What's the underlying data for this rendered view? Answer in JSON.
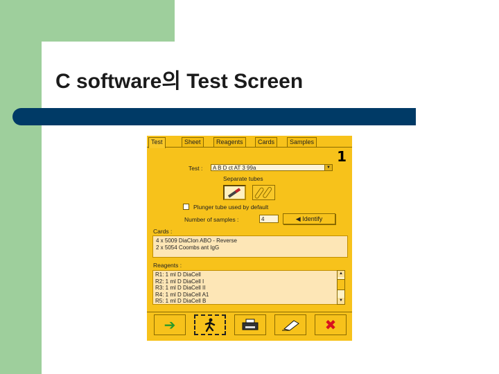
{
  "slide": {
    "title": "C software의 Test Screen"
  },
  "colors": {
    "green": "#9ecf9c",
    "navy": "#003a66",
    "app_bg": "#f7c21b",
    "field_bg": "#fde6b6"
  },
  "app": {
    "tabs": [
      "Test",
      "Sheet",
      "Reagents",
      "Cards",
      "Samples"
    ],
    "active_tab": "Test",
    "panel_number": "1",
    "test_label": "Test :",
    "test_value": "A B D ct AT 3 99a",
    "separate_tubes_label": "Separate tubes",
    "plunger_label": "Plunger tube used by default",
    "num_samples_label": "Number of samples :",
    "num_samples_value": "4",
    "identify_label": "◀ Identify",
    "cards_label": "Cards :",
    "cards": [
      "4 x 5009 DiaClon ABO - Reverse",
      "2 x 5054 Coombs ant IgG"
    ],
    "reagents_label": "Reagents :",
    "reagents": [
      "R1: 1 ml D DiaCell",
      "R2: 1 ml D DiaCell I",
      "R3: 1 ml D DiaCell II",
      "R4: 1 ml D DiaCell A1",
      "R5: 1 ml D DiaCell B"
    ],
    "toolbar_icons": [
      "arrow-right-icon",
      "runner-icon",
      "printer-icon",
      "eraser-icon",
      "cancel-x-icon"
    ]
  }
}
